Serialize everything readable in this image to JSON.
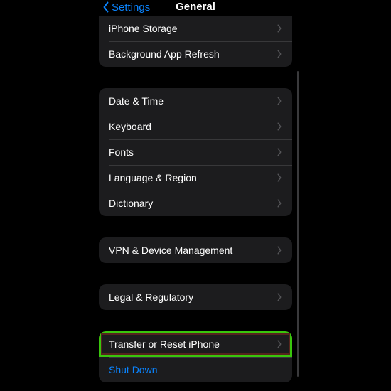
{
  "nav": {
    "back_label": "Settings",
    "title": "General"
  },
  "groups": [
    {
      "rows": [
        {
          "label": "iPhone Storage"
        },
        {
          "label": "Background App Refresh"
        }
      ]
    },
    {
      "rows": [
        {
          "label": "Date & Time"
        },
        {
          "label": "Keyboard"
        },
        {
          "label": "Fonts"
        },
        {
          "label": "Language & Region"
        },
        {
          "label": "Dictionary"
        }
      ]
    },
    {
      "rows": [
        {
          "label": "VPN & Device Management"
        }
      ]
    },
    {
      "rows": [
        {
          "label": "Legal & Regulatory"
        }
      ]
    },
    {
      "rows": [
        {
          "label": "Transfer or Reset iPhone"
        },
        {
          "label": "Shut Down",
          "link": true,
          "nochev": true
        }
      ],
      "highlight": true
    }
  ]
}
